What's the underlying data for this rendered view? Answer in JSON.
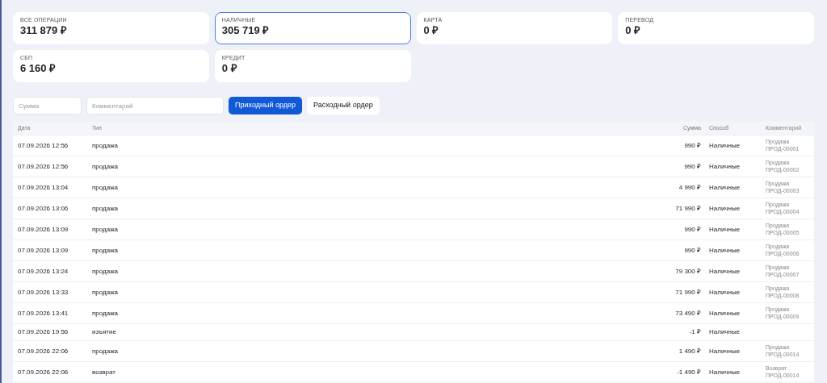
{
  "summary_cards": [
    {
      "label": "ВСЕ ОПЕРАЦИИ",
      "value": "311 879 ₽",
      "selected": false
    },
    {
      "label": "НАЛИЧНЫЕ",
      "value": "305 719 ₽",
      "selected": true
    },
    {
      "label": "КАРТА",
      "value": "0 ₽",
      "selected": false
    },
    {
      "label": "ПЕРЕВОД",
      "value": "0 ₽",
      "selected": false
    },
    {
      "label": "СБП",
      "value": "6 160 ₽",
      "selected": false
    },
    {
      "label": "КРЕДИТ",
      "value": "0 ₽",
      "selected": false
    }
  ],
  "form": {
    "amount": {
      "placeholder": "Сумма"
    },
    "comment": {
      "placeholder": "Комментарий"
    },
    "buttons": [
      {
        "label": "Приходный ордер",
        "kind": "primary"
      },
      {
        "label": "Расходный ордер",
        "kind": "secondary"
      }
    ]
  },
  "table": {
    "columns": [
      "Дата",
      "Тип",
      "Сумма",
      "Способ",
      "Комментарий"
    ],
    "rows": [
      {
        "date": "07.09.2026 12:56",
        "type": "продажа",
        "amount": "990 ₽",
        "method": "Наличные",
        "comment": "Продажа ПРОД-00001"
      },
      {
        "date": "07.09.2026 12:56",
        "type": "продажа",
        "amount": "990 ₽",
        "method": "Наличные",
        "comment": "Продажа ПРОД-00002"
      },
      {
        "date": "07.09.2026 13:04",
        "type": "продажа",
        "amount": "4 990 ₽",
        "method": "Наличные",
        "comment": "Продажа ПРОД-00003"
      },
      {
        "date": "07.09.2026 13:06",
        "type": "продажа",
        "amount": "71 990 ₽",
        "method": "Наличные",
        "comment": "Продажа ПРОД-00004"
      },
      {
        "date": "07.09.2026 13:09",
        "type": "продажа",
        "amount": "990 ₽",
        "method": "Наличные",
        "comment": "Продажа ПРОД-00005"
      },
      {
        "date": "07.09.2026 13:09",
        "type": "продажа",
        "amount": "990 ₽",
        "method": "Наличные",
        "comment": "Продажа ПРОД-00006"
      },
      {
        "date": "07.09.2026 13:24",
        "type": "продажа",
        "amount": "79 300 ₽",
        "method": "Наличные",
        "comment": "Продажа ПРОД-00007"
      },
      {
        "date": "07.09.2026 13:33",
        "type": "продажа",
        "amount": "71 990 ₽",
        "method": "Наличные",
        "comment": "Продажа ПРОД-00008"
      },
      {
        "date": "07.09.2026 13:41",
        "type": "продажа",
        "amount": "73 490 ₽",
        "method": "Наличные",
        "comment": "Продажа ПРОД-00009"
      },
      {
        "date": "07.09.2026 19:56",
        "type": "изъятие",
        "amount": "-1 ₽",
        "method": "Наличные"
      },
      {
        "date": "07.09.2026 22:06",
        "type": "продажа",
        "amount": "1 490 ₽",
        "method": "Наличные",
        "comment": "Продажа ПРОД-00014"
      },
      {
        "date": "07.09.2026 22:06",
        "type": "возврат",
        "amount": "-1 490 ₽",
        "method": "Наличные",
        "comment": "Возврат ПРОД-00014"
      }
    ]
  }
}
